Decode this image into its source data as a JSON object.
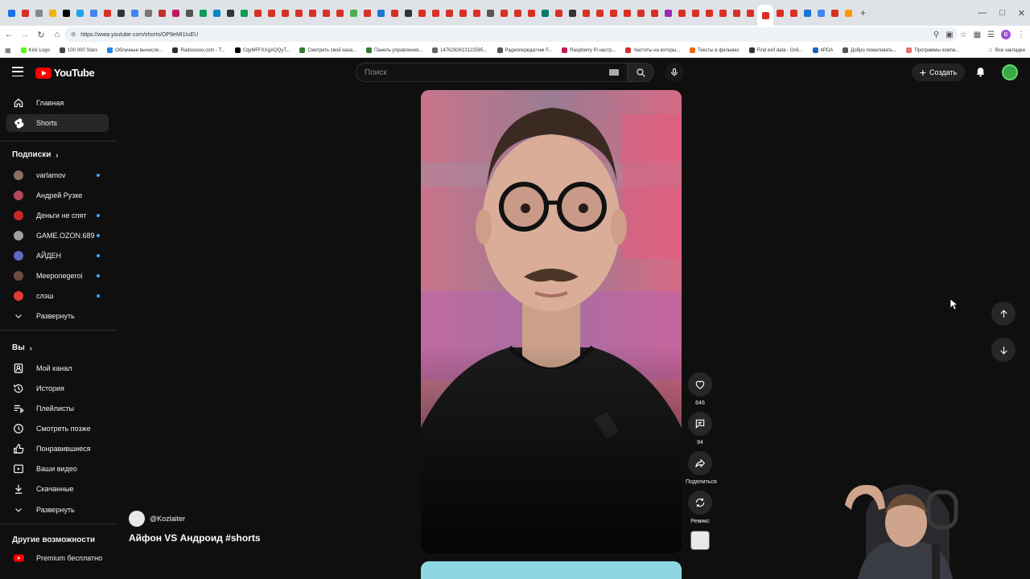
{
  "browser": {
    "url": "https://www.youtube.com/shorts/OP9eMI1IuEU",
    "tab_colors": [
      "#1a73e8",
      "#d93025",
      "#888888",
      "#f4b400",
      "#000000",
      "#1da1f2",
      "#4285f4",
      "#d93025",
      "#333333",
      "#4285f4",
      "#777777",
      "#c4302b",
      "#c2185b",
      "#555555",
      "#0f9d58",
      "#0088cc",
      "#333333",
      "#0f9d58",
      "#d93025",
      "#d93025",
      "#d93025",
      "#d93025",
      "#d93025",
      "#d93025",
      "#d93025",
      "#4caf50",
      "#d93025",
      "#1976d2",
      "#d93025",
      "#333333",
      "#d93025",
      "#d93025",
      "#d93025",
      "#d93025",
      "#d93025",
      "#555555",
      "#d93025",
      "#d93025",
      "#d93025",
      "#00796b",
      "#d93025",
      "#333333",
      "#d93025",
      "#d93025",
      "#d93025",
      "#d93025",
      "#d93025",
      "#d93025",
      "#9c27b0",
      "#d93025",
      "#d93025",
      "#d93025",
      "#d93025",
      "#d93025",
      "#d93025",
      "#d93025",
      "#d93025",
      "#d93025",
      "#1976d2",
      "#4285f4",
      "#d93025",
      "#ff9800"
    ],
    "bookmarks": [
      {
        "label": "Kick Logo",
        "color": "#53fc18"
      },
      {
        "label": "100 000 Stars",
        "color": "#444444"
      },
      {
        "label": "Облачные вычисле...",
        "color": "#1e88e5"
      },
      {
        "label": "Radiooooo.com - T...",
        "color": "#263238"
      },
      {
        "label": "CqyMFFXXgAQQyT...",
        "color": "#000000"
      },
      {
        "label": "Смотреть свой кана...",
        "color": "#2e7d32"
      },
      {
        "label": "Панель управления...",
        "color": "#2e7d32"
      },
      {
        "label": "1476282613122595...",
        "color": "#666666"
      },
      {
        "label": "Радиопередатчик F...",
        "color": "#555555"
      },
      {
        "label": "Raspberry Pi настр...",
        "color": "#c51a4a"
      },
      {
        "label": "Частоты на которы...",
        "color": "#d32f2f"
      },
      {
        "label": "Тексты в фильмах",
        "color": "#ef6c00"
      },
      {
        "label": "Find exif data - Onli...",
        "color": "#333333"
      },
      {
        "label": "4PDA",
        "color": "#1565c0"
      },
      {
        "label": "Добро пожаловать...",
        "color": "#555555"
      },
      {
        "label": "Программы компа...",
        "color": "#e57373"
      }
    ],
    "all_bookmarks": "Все закладки"
  },
  "masthead": {
    "logo_text": "YouTube",
    "search_placeholder": "Поиск",
    "create_label": "Создать"
  },
  "sidebar": {
    "main": [
      {
        "label": "Главная",
        "icon": "home-icon"
      },
      {
        "label": "Shorts",
        "icon": "shorts-icon"
      }
    ],
    "subscriptions_title": "Подписки",
    "subscriptions": [
      {
        "label": "varlamov",
        "color": "#8d6e63",
        "live": true
      },
      {
        "label": "Андрей Рузке",
        "color": "#b04a5a",
        "live": false
      },
      {
        "label": "Деньги не спят",
        "color": "#c62828",
        "live": true
      },
      {
        "label": "GAME.OZON.689",
        "color": "#9e9e9e",
        "live": true
      },
      {
        "label": "АЙДЕН",
        "color": "#5c6bc0",
        "live": true
      },
      {
        "label": "Meeponegeroi",
        "color": "#6d4c41",
        "live": true
      },
      {
        "label": "слэш",
        "color": "#e53935",
        "live": true
      }
    ],
    "expand_label": "Развернуть",
    "you_title": "Вы",
    "you": [
      {
        "label": "Мой канал",
        "icon": "channel-icon"
      },
      {
        "label": "История",
        "icon": "history-icon"
      },
      {
        "label": "Плейлисты",
        "icon": "playlists-icon"
      },
      {
        "label": "Смотреть позже",
        "icon": "watch-later-icon"
      },
      {
        "label": "Понравившиеся",
        "icon": "like-icon"
      },
      {
        "label": "Ваши видео",
        "icon": "your-videos-icon"
      },
      {
        "label": "Скачанные",
        "icon": "download-icon"
      }
    ],
    "expand_label_2": "Развернуть",
    "more_title": "Другие возможности",
    "premium_label": "Premium бесплатно"
  },
  "short": {
    "channel": "@Kozlaiter",
    "title": "Айфон VS Андроид #shorts",
    "likes": "646",
    "comments": "94",
    "share_label": "Поделиться",
    "remix_label": "Ремикс"
  }
}
